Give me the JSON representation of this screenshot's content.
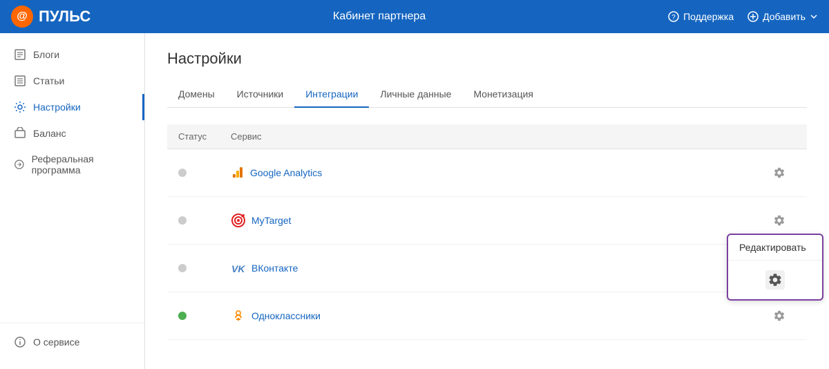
{
  "header": {
    "logo_text": "ПУЛЬС",
    "center_text": "Кабинет партнера",
    "support_label": "Поддержка",
    "add_label": "Добавить"
  },
  "sidebar": {
    "items": [
      {
        "id": "blogs",
        "label": "Блоги",
        "icon": "book"
      },
      {
        "id": "articles",
        "label": "Статьи",
        "icon": "article"
      },
      {
        "id": "settings",
        "label": "Настройки",
        "icon": "gear",
        "active": true
      },
      {
        "id": "balance",
        "label": "Баланс",
        "icon": "balance"
      },
      {
        "id": "referral",
        "label": "Реферальная программа",
        "icon": "referral"
      }
    ],
    "bottom_items": [
      {
        "id": "about",
        "label": "О сервисе",
        "icon": "info"
      }
    ]
  },
  "page": {
    "title": "Настройки"
  },
  "tabs": [
    {
      "id": "domains",
      "label": "Домены",
      "active": false
    },
    {
      "id": "sources",
      "label": "Источники",
      "active": false
    },
    {
      "id": "integrations",
      "label": "Интеграции",
      "active": true
    },
    {
      "id": "personal",
      "label": "Личные данные",
      "active": false
    },
    {
      "id": "monetization",
      "label": "Монетизация",
      "active": false
    }
  ],
  "table": {
    "columns": {
      "status": "Статус",
      "service": "Сервис"
    },
    "rows": [
      {
        "id": "ga",
        "status": "inactive",
        "name": "Google Analytics",
        "icon": "ga"
      },
      {
        "id": "mt",
        "status": "inactive",
        "name": "MyTarget",
        "icon": "mt"
      },
      {
        "id": "vk",
        "status": "inactive",
        "name": "ВКонтакте",
        "icon": "vk"
      },
      {
        "id": "ok",
        "status": "active",
        "name": "Одноклассники",
        "icon": "ok"
      }
    ]
  },
  "popup": {
    "edit_label": "Редактировать"
  },
  "colors": {
    "primary": "#1565c0",
    "active_dot": "#4caf50",
    "inactive_dot": "#cccccc",
    "popup_border": "#7b3fa0"
  }
}
